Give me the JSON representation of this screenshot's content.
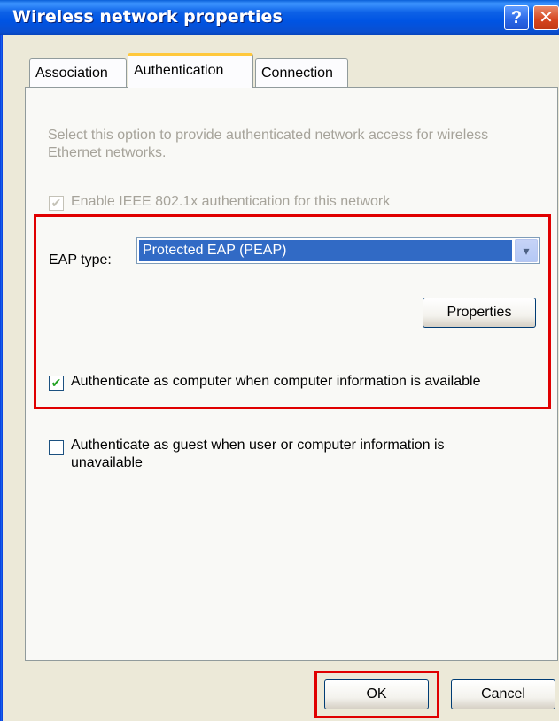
{
  "window": {
    "title": "Wireless network properties"
  },
  "titlebar": {
    "help_glyph": "?",
    "close_glyph": "✕"
  },
  "tabs": [
    {
      "label": "Association"
    },
    {
      "label": "Authentication"
    },
    {
      "label": "Connection"
    }
  ],
  "auth": {
    "description": "Select this option to provide authenticated network access for wireless Ethernet networks.",
    "enable_8021x": {
      "label": "Enable IEEE 802.1x authentication for this network",
      "checked": true,
      "disabled": true
    },
    "eap_type": {
      "label": "EAP type:",
      "value": "Protected EAP (PEAP)",
      "dropdown_glyph": "▾"
    },
    "properties_button": "Properties",
    "auth_as_computer": {
      "label": "Authenticate as computer when computer information is available",
      "checked": true
    },
    "auth_as_guest": {
      "label_line1": "Authenticate as guest when user or computer information is",
      "label_line2": "unavailable",
      "checked": false
    },
    "check_glyph": "✔"
  },
  "footer": {
    "ok_label": "OK",
    "cancel_label": "Cancel"
  },
  "colors": {
    "highlight_box": "#e00000",
    "titlebar": "#0054e3",
    "selection": "#316ac5"
  }
}
